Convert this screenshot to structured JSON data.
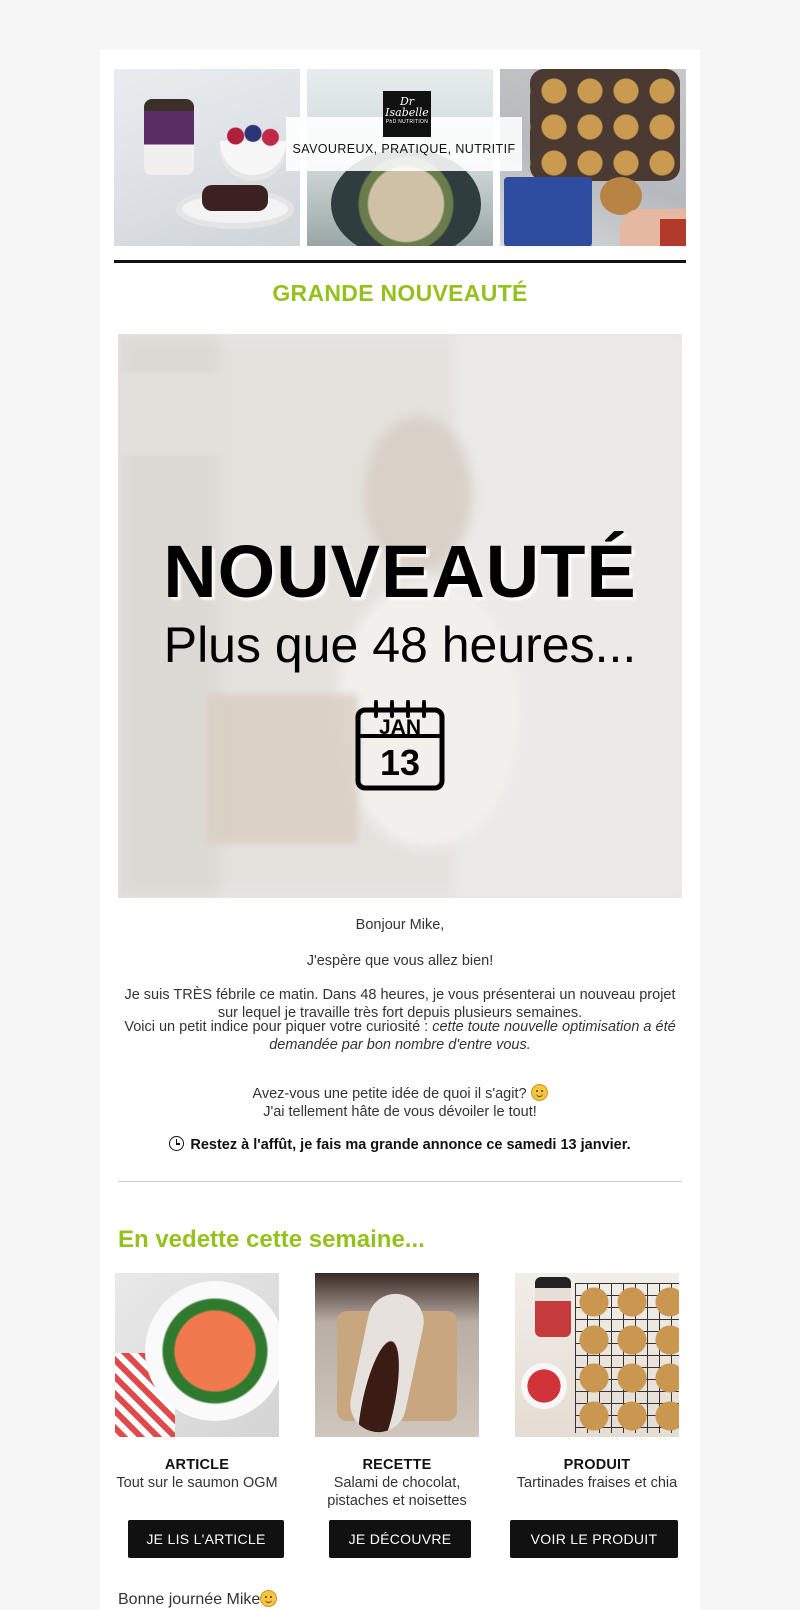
{
  "header": {
    "logo_line1": "Dr",
    "logo_line2": "Isabelle",
    "logo_small": "PhD NUTRITION",
    "tagline": "SAVOUREUX, PRATIQUE, NUTRITIF"
  },
  "section_title": "GRANDE NOUVEAUTÉ",
  "hero": {
    "title": "NOUVEAUTÉ",
    "subtitle": "Plus que 48 heures...",
    "calendar_month": "JAN",
    "calendar_day": "13"
  },
  "body": {
    "greeting": "Bonjour Mike,",
    "hope": "J'espère que vous allez bien!",
    "p1": "Je suis TRÈS fébrile ce matin. Dans 48 heures, je vous présenterai un nouveau projet sur lequel je travaille très fort depuis plusieurs semaines.",
    "p2_lead": "Voici un petit indice pour piquer votre curiosité : ",
    "p2_italic": "cette toute nouvelle optimisation a été demandée par bon nombre d'entre vous.",
    "p3_line1": "Avez-vous une petite idée de quoi il s'agit? ",
    "p3_line2": "J'ai tellement hâte de vous dévoiler le tout!",
    "announce": "Restez à l'affût, je fais ma grande annonce ce samedi 13 janvier."
  },
  "featured": {
    "title": "En vedette cette semaine...",
    "items": [
      {
        "label": "ARTICLE",
        "description": "Tout sur le saumon OGM",
        "button": "JE LIS L'ARTICLE"
      },
      {
        "label": "RECETTE",
        "description": "Salami de chocolat, pistaches et noisettes",
        "button": "JE DÉCOUVRE"
      },
      {
        "label": "PRODUIT",
        "description": "Tartinades fraises et chia",
        "button": "VOIR LE PRODUIT"
      }
    ]
  },
  "closing": "Bonne journée Mike",
  "colors": {
    "accent": "#95c11f",
    "button_bg": "#111111",
    "page_bg": "#f6f6f6"
  }
}
